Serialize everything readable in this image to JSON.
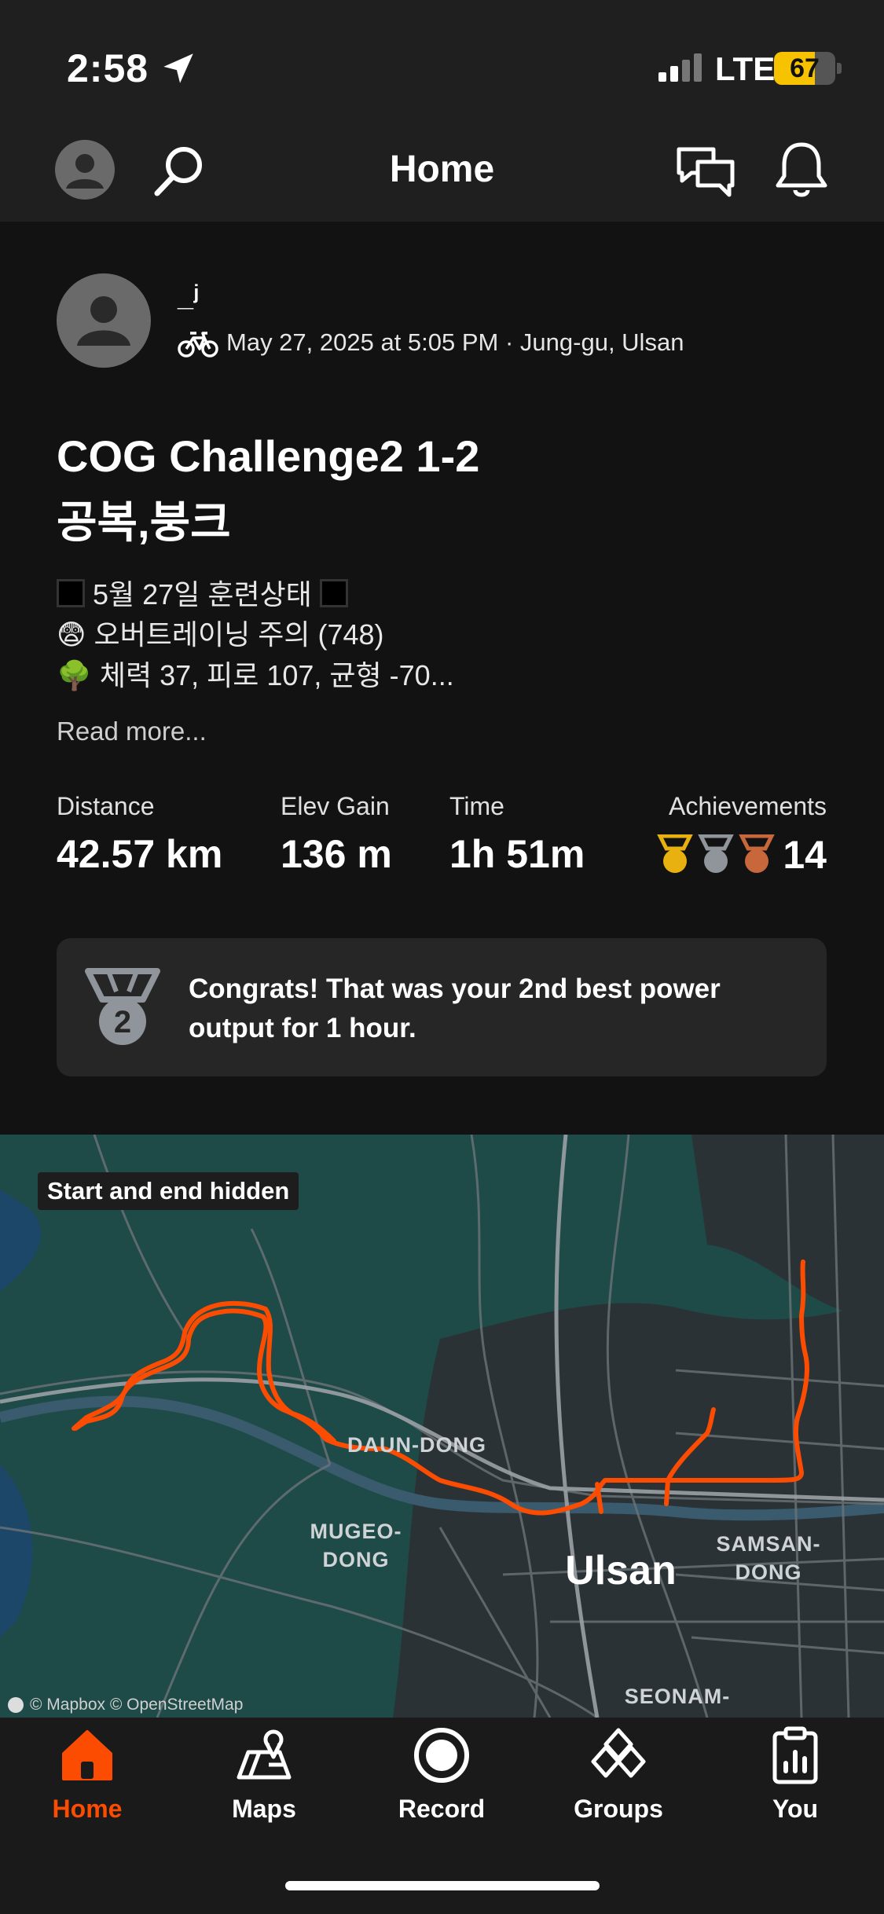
{
  "status_bar": {
    "time": "2:58",
    "network": "LTE",
    "battery": "67",
    "battery_level": 0.67
  },
  "nav": {
    "title": "Home"
  },
  "post": {
    "athlete": "_ʲ",
    "meta": "May 27, 2025 at 5:05 PM · Jung-gu, Ulsan",
    "title_line1": "COG Challenge2 1-2",
    "title_line2": "공복,붕크",
    "description": [
      "5월 27일 훈련상태",
      "😨 오버트레이닝 주의 (748)",
      "🌳 체력 37, 피로 107, 균형 -70..."
    ],
    "read_more": "Read more...",
    "stats": {
      "distance_label": "Distance",
      "distance_value": "42.57 km",
      "elev_label": "Elev Gain",
      "elev_value": "136 m",
      "time_label": "Time",
      "time_value": "1h 51m",
      "achievements_label": "Achievements",
      "achievements_count": "14"
    },
    "congrats": {
      "medal_number": "2",
      "text": "Congrats! That was your 2nd best power output for 1 hour."
    }
  },
  "map": {
    "badge": "Start and end hidden",
    "credit": "© Mapbox © OpenStreetMap",
    "labels": {
      "daun": "DAUN-DONG",
      "mugeo_1": "MUGEO-",
      "mugeo_2": "DONG",
      "ulsan": "Ulsan",
      "samsan_1": "SAMSAN-",
      "samsan_2": "DONG",
      "seonam": "SEONAM-"
    },
    "route_color": "#fc4c02"
  },
  "tabs": [
    {
      "label": "Home",
      "icon": "home-icon",
      "active": true
    },
    {
      "label": "Maps",
      "icon": "maps-icon"
    },
    {
      "label": "Record",
      "icon": "record-icon"
    },
    {
      "label": "Groups",
      "icon": "groups-icon"
    },
    {
      "label": "You",
      "icon": "you-icon"
    }
  ],
  "colors": {
    "accent": "#fc4c02",
    "gold": "#e8b10f",
    "silver": "#8f959a",
    "bronze": "#c8673c"
  }
}
